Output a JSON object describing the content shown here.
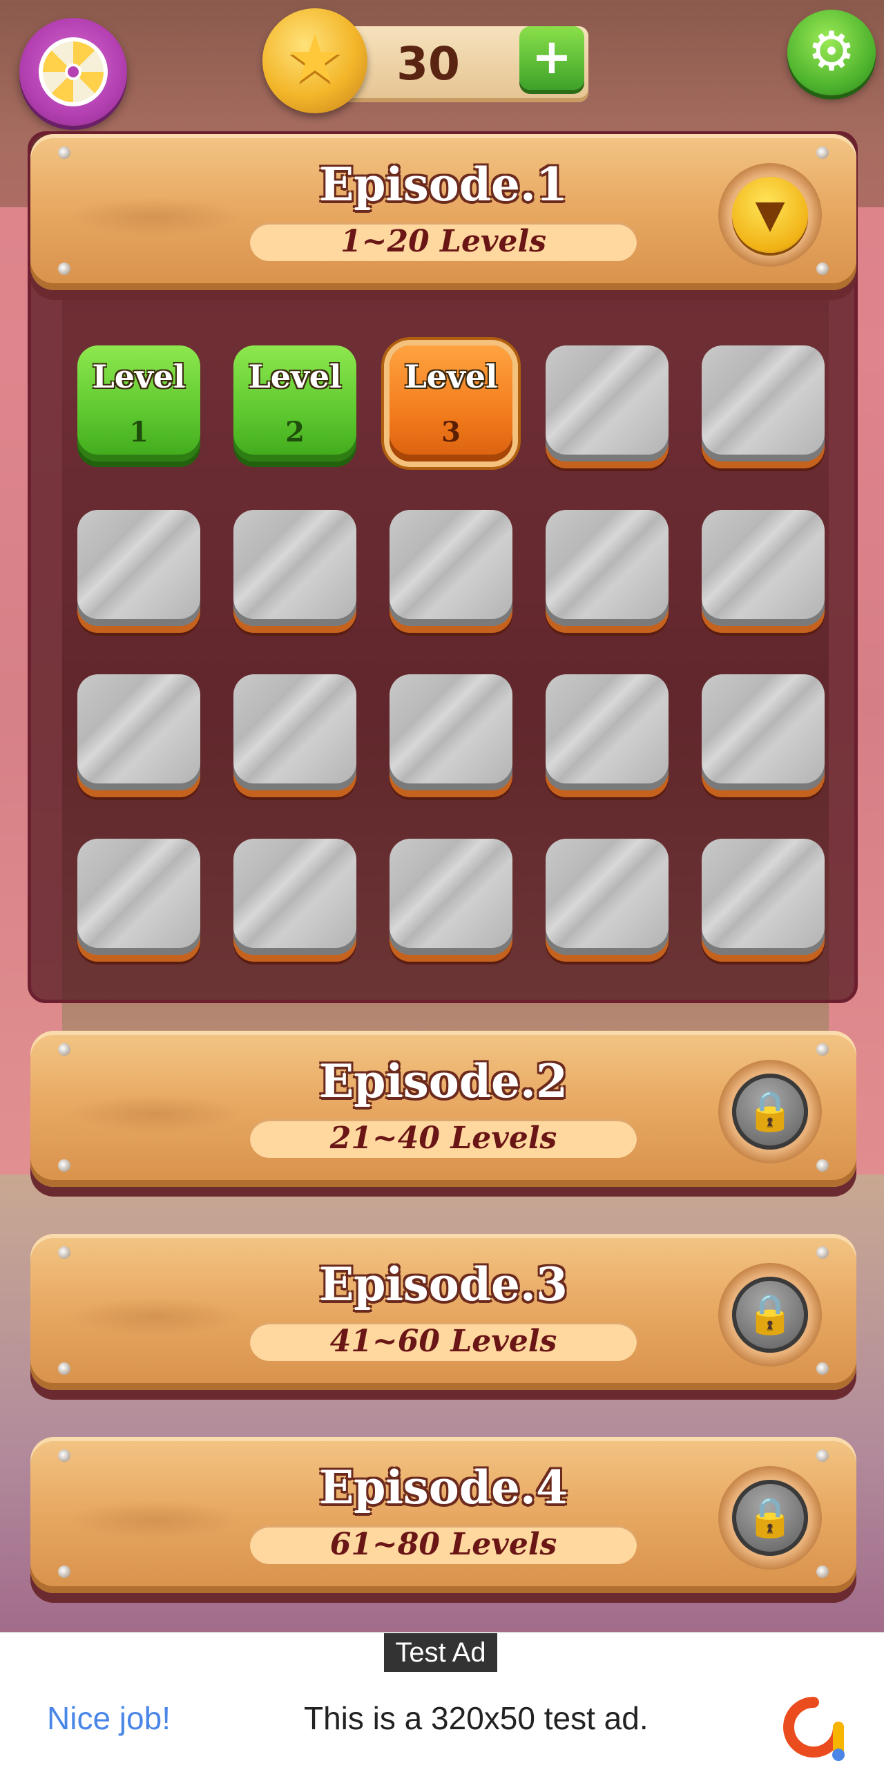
{
  "header": {
    "coins": "30",
    "wheel_icon": "prize-wheel-icon",
    "coin_icon": "star-coin-icon",
    "plus_icon": "plus-icon",
    "settings_icon": "gear-icon"
  },
  "episodes": [
    {
      "title": "Episode.1",
      "range": "1~20 Levels",
      "state": "expanded",
      "button_icon": "chevron-down-icon"
    },
    {
      "title": "Episode.2",
      "range": "21~40 Levels",
      "state": "locked",
      "button_icon": "lock-icon"
    },
    {
      "title": "Episode.3",
      "range": "41~60 Levels",
      "state": "locked",
      "button_icon": "lock-icon"
    },
    {
      "title": "Episode.4",
      "range": "61~80 Levels",
      "state": "locked",
      "button_icon": "lock-icon"
    }
  ],
  "levels": {
    "label": "Level",
    "items": [
      {
        "number": "1",
        "state": "completed"
      },
      {
        "number": "2",
        "state": "completed"
      },
      {
        "number": "3",
        "state": "current"
      },
      {
        "number": "",
        "state": "locked"
      },
      {
        "number": "",
        "state": "locked"
      },
      {
        "number": "",
        "state": "locked"
      },
      {
        "number": "",
        "state": "locked"
      },
      {
        "number": "",
        "state": "locked"
      },
      {
        "number": "",
        "state": "locked"
      },
      {
        "number": "",
        "state": "locked"
      },
      {
        "number": "",
        "state": "locked"
      },
      {
        "number": "",
        "state": "locked"
      },
      {
        "number": "",
        "state": "locked"
      },
      {
        "number": "",
        "state": "locked"
      },
      {
        "number": "",
        "state": "locked"
      },
      {
        "number": "",
        "state": "locked"
      },
      {
        "number": "",
        "state": "locked"
      },
      {
        "number": "",
        "state": "locked"
      },
      {
        "number": "",
        "state": "locked"
      },
      {
        "number": "",
        "state": "locked"
      }
    ]
  },
  "ad": {
    "tag": "Test Ad",
    "cta": "Nice job!",
    "message": "This is a 320x50 test ad.",
    "logo_icon": "ad-logo-icon"
  },
  "colors": {
    "completed": "#5cc72e",
    "current": "#f27b1c",
    "locked": "#bdbdbd",
    "wood": "#e8aa64",
    "title_outline": "#6b2a1d"
  }
}
